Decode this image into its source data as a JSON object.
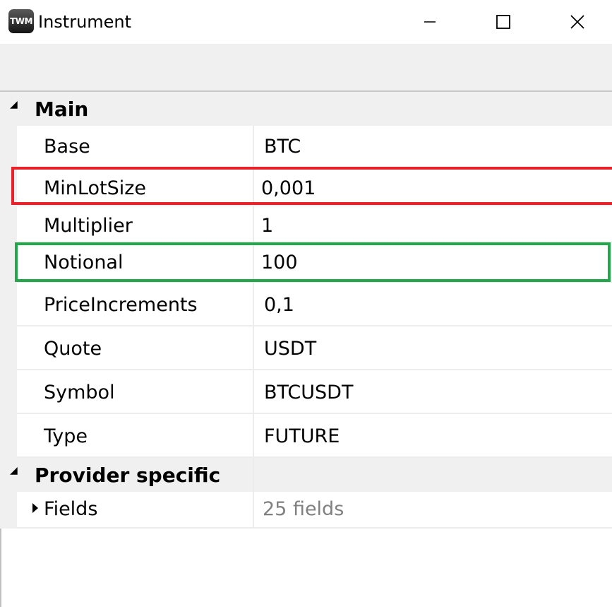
{
  "window": {
    "title": "Instrument",
    "app_icon_text": "TWM"
  },
  "groups": [
    {
      "label": "Main",
      "rows": [
        {
          "name": "Base",
          "value": "BTC"
        },
        {
          "name": "MinLotSize",
          "value": "0,001"
        },
        {
          "name": "Multiplier",
          "value": "1"
        },
        {
          "name": "Notional",
          "value": "100"
        },
        {
          "name": "PriceIncrements",
          "value": "0,1"
        },
        {
          "name": "Quote",
          "value": "USDT"
        },
        {
          "name": "Symbol",
          "value": "BTCUSDT"
        },
        {
          "name": "Type",
          "value": "FUTURE"
        }
      ]
    },
    {
      "label": "Provider specific",
      "rows": [
        {
          "name": "Fields",
          "value": "25 fields"
        }
      ]
    }
  ],
  "highlights": {
    "red_color": "#e8212a",
    "green_color": "#22a84a"
  }
}
